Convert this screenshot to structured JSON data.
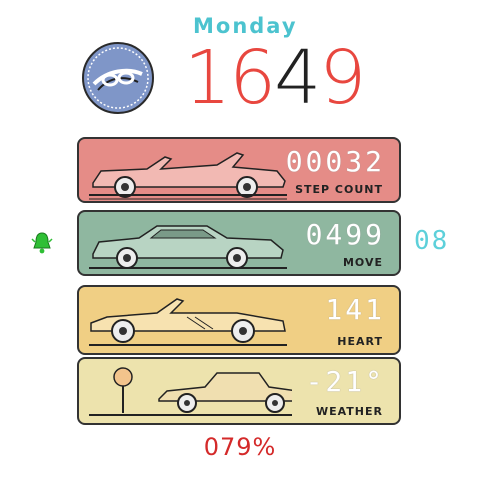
{
  "header": {
    "day": "Monday"
  },
  "time": {
    "hours": "16",
    "minute_tens": "4",
    "minute_ones": "9"
  },
  "cards": [
    {
      "value": "00032",
      "label": "STEP COUNT",
      "color": "#e58c87",
      "icon": "convertible-car-icon"
    },
    {
      "value": "0499",
      "label": "MOVE",
      "color": "#8fb7a0",
      "icon": "muscle-car-icon"
    },
    {
      "value": "141",
      "label": "HEART",
      "color": "#f0cf84",
      "icon": "sports-car-icon"
    },
    {
      "value": "-21°",
      "label": "WEATHER",
      "color": "#ede3ad",
      "icon": "sedan-car-icon"
    }
  ],
  "alarm": {
    "icon": "bell-icon",
    "value": "08"
  },
  "battery": "079%"
}
